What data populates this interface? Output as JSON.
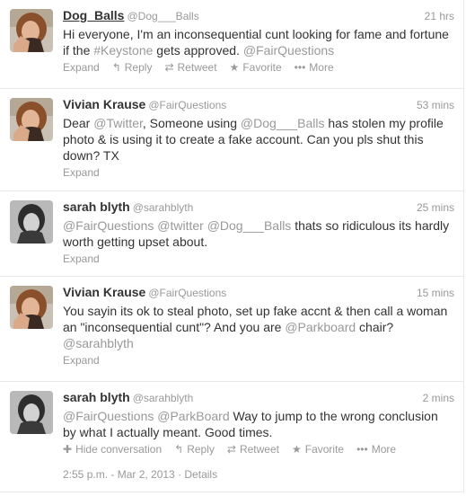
{
  "tweets": [
    {
      "fullname": "Dog_Balls",
      "username": "@Dog___Balls",
      "time": "21 hrs",
      "text": [
        {
          "t": "Hi everyone, I'm an inconsequential cunt looking for fame and fortune if the "
        },
        {
          "t": "#Keystone",
          "link": true
        },
        {
          "t": " gets approved. "
        },
        {
          "t": "@FairQuestions",
          "link": true
        }
      ],
      "actions": [
        {
          "label": "Expand"
        },
        {
          "label": "Reply",
          "icon": "↰"
        },
        {
          "label": "Retweet",
          "icon": "⇄"
        },
        {
          "label": "Favorite",
          "icon": "★"
        },
        {
          "label": "More",
          "icon": "•••"
        }
      ],
      "avatar": "woman-hand-on-face"
    },
    {
      "fullname": "Vivian Krause",
      "username": "@FairQuestions",
      "time": "53 mins",
      "text": [
        {
          "t": "Dear "
        },
        {
          "t": "@Twitter",
          "link": true
        },
        {
          "t": ", Someone using "
        },
        {
          "t": "@Dog___Balls",
          "link": true
        },
        {
          "t": " has stolen my profile photo & is using it to create a fake account. Can you pls shut this down? TX"
        }
      ],
      "expand": "Expand",
      "avatar": "woman-hand-on-face"
    },
    {
      "fullname": "sarah blyth",
      "username": "@sarahblyth",
      "time": "25 mins",
      "text": [
        {
          "t": "@FairQuestions",
          "link": true
        },
        {
          "t": " "
        },
        {
          "t": "@twitter",
          "link": true
        },
        {
          "t": " "
        },
        {
          "t": "@Dog___Balls",
          "link": true
        },
        {
          "t": " thats so ridiculous its hardly worth getting upset about."
        }
      ],
      "expand": "Expand",
      "avatar": "woman-dark-hair"
    },
    {
      "fullname": "Vivian Krause",
      "username": "@FairQuestions",
      "time": "15 mins",
      "text": [
        {
          "t": "You sayin its ok to steal photo, set up fake accnt & then call a woman an \"inconsequential cunt\"? And you are "
        },
        {
          "t": "@Parkboard",
          "link": true
        },
        {
          "t": " chair? "
        },
        {
          "t": "@sarahblyth",
          "link": true
        }
      ],
      "expand": "Expand",
      "avatar": "woman-hand-on-face"
    },
    {
      "fullname": "sarah blyth",
      "username": "@sarahblyth",
      "time": "2 mins",
      "text": [
        {
          "t": "@FairQuestions",
          "link": true
        },
        {
          "t": " "
        },
        {
          "t": "@ParkBoard",
          "link": true
        },
        {
          "t": " Way to jump to the wrong conclusion by what I actually meant. Good times."
        }
      ],
      "actions": [
        {
          "label": "Hide conversation",
          "icon": "✚"
        },
        {
          "label": "Reply",
          "icon": "↰"
        },
        {
          "label": "Retweet",
          "icon": "⇄"
        },
        {
          "label": "Favorite",
          "icon": "★"
        },
        {
          "label": "More",
          "icon": "•••"
        }
      ],
      "timestamp": "2:55 p.m. - Mar 2, 2013 · Details",
      "avatar": "woman-dark-hair"
    }
  ],
  "colors": {
    "text": "#333333",
    "muted": "#999999",
    "border": "#e8e8e8"
  }
}
